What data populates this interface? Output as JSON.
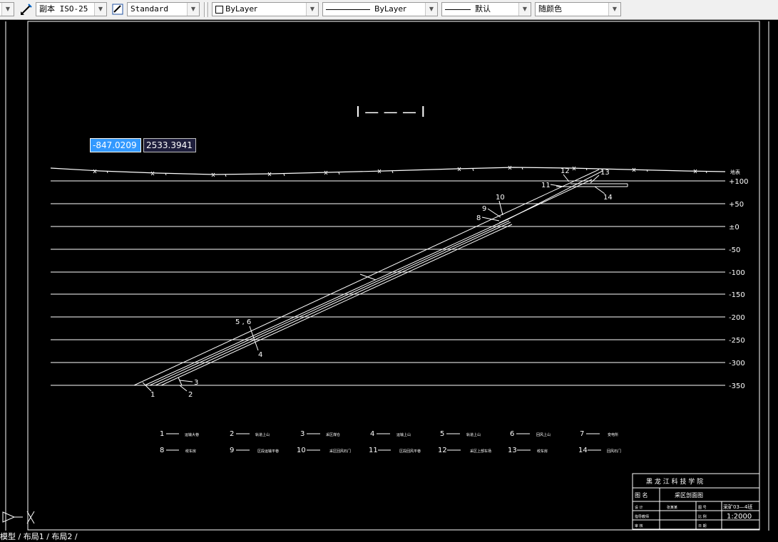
{
  "toolbar": {
    "dimstyle": "副本 ISO-25",
    "textstyle": "Standard",
    "layer_color": "ByLayer",
    "linetype": "ByLayer",
    "lineweight": "默认",
    "plotstyle": "随颜色"
  },
  "coordinate_input": {
    "x": "-847.0209",
    "y": "2533.3941"
  },
  "drawing": {
    "section_title": "I — — — I",
    "surface_label": "地表",
    "levels": [
      "+100",
      "+50",
      "±0",
      "-50",
      "-100",
      "-150",
      "-200",
      "-250",
      "-300",
      "-350"
    ],
    "callouts": [
      "1",
      "2",
      "3",
      "4",
      "5 , 6",
      "8",
      "9",
      "10",
      "11",
      "12",
      "13",
      "14"
    ],
    "legend": [
      {
        "num": "1",
        "text": "运输大巷"
      },
      {
        "num": "2",
        "text": "轨道上山"
      },
      {
        "num": "3",
        "text": "采区煤仓"
      },
      {
        "num": "4",
        "text": "运输上山"
      },
      {
        "num": "5",
        "text": "轨道上山"
      },
      {
        "num": "6",
        "text": "回风上山"
      },
      {
        "num": "7",
        "text": "变电所"
      },
      {
        "num": "8",
        "text": "绞车房"
      },
      {
        "num": "9",
        "text": "区段运输平巷"
      },
      {
        "num": "10",
        "text": "采区回风石门"
      },
      {
        "num": "11",
        "text": "区段回风平巷"
      },
      {
        "num": "12",
        "text": "采区上部车场"
      },
      {
        "num": "13",
        "text": "绞车房"
      },
      {
        "num": "14",
        "text": "回风石门"
      }
    ]
  },
  "title_block": {
    "school": "黑 龙 江 科 技 学 院",
    "name_label": "图 名",
    "name_value": "采区剖面图",
    "row1": [
      "设 计",
      "张某某",
      "图 号",
      "采矿03—4班"
    ],
    "row2": [
      "指导教师",
      "",
      "比 例",
      "1:2000"
    ],
    "row3": [
      "审 核",
      "",
      "日 期",
      ""
    ]
  },
  "status_line": "模型 / 布局1 / 布局2 /"
}
